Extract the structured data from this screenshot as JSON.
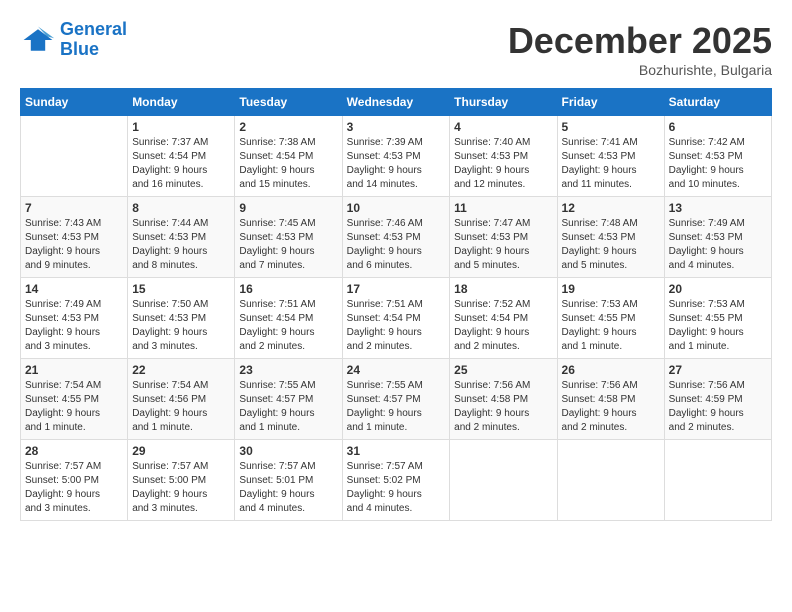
{
  "header": {
    "logo_line1": "General",
    "logo_line2": "Blue",
    "month": "December 2025",
    "location": "Bozhurishte, Bulgaria"
  },
  "weekdays": [
    "Sunday",
    "Monday",
    "Tuesday",
    "Wednesday",
    "Thursday",
    "Friday",
    "Saturday"
  ],
  "weeks": [
    [
      {
        "day": "",
        "info": ""
      },
      {
        "day": "1",
        "info": "Sunrise: 7:37 AM\nSunset: 4:54 PM\nDaylight: 9 hours\nand 16 minutes."
      },
      {
        "day": "2",
        "info": "Sunrise: 7:38 AM\nSunset: 4:54 PM\nDaylight: 9 hours\nand 15 minutes."
      },
      {
        "day": "3",
        "info": "Sunrise: 7:39 AM\nSunset: 4:53 PM\nDaylight: 9 hours\nand 14 minutes."
      },
      {
        "day": "4",
        "info": "Sunrise: 7:40 AM\nSunset: 4:53 PM\nDaylight: 9 hours\nand 12 minutes."
      },
      {
        "day": "5",
        "info": "Sunrise: 7:41 AM\nSunset: 4:53 PM\nDaylight: 9 hours\nand 11 minutes."
      },
      {
        "day": "6",
        "info": "Sunrise: 7:42 AM\nSunset: 4:53 PM\nDaylight: 9 hours\nand 10 minutes."
      }
    ],
    [
      {
        "day": "7",
        "info": "Sunrise: 7:43 AM\nSunset: 4:53 PM\nDaylight: 9 hours\nand 9 minutes."
      },
      {
        "day": "8",
        "info": "Sunrise: 7:44 AM\nSunset: 4:53 PM\nDaylight: 9 hours\nand 8 minutes."
      },
      {
        "day": "9",
        "info": "Sunrise: 7:45 AM\nSunset: 4:53 PM\nDaylight: 9 hours\nand 7 minutes."
      },
      {
        "day": "10",
        "info": "Sunrise: 7:46 AM\nSunset: 4:53 PM\nDaylight: 9 hours\nand 6 minutes."
      },
      {
        "day": "11",
        "info": "Sunrise: 7:47 AM\nSunset: 4:53 PM\nDaylight: 9 hours\nand 5 minutes."
      },
      {
        "day": "12",
        "info": "Sunrise: 7:48 AM\nSunset: 4:53 PM\nDaylight: 9 hours\nand 5 minutes."
      },
      {
        "day": "13",
        "info": "Sunrise: 7:49 AM\nSunset: 4:53 PM\nDaylight: 9 hours\nand 4 minutes."
      }
    ],
    [
      {
        "day": "14",
        "info": "Sunrise: 7:49 AM\nSunset: 4:53 PM\nDaylight: 9 hours\nand 3 minutes."
      },
      {
        "day": "15",
        "info": "Sunrise: 7:50 AM\nSunset: 4:53 PM\nDaylight: 9 hours\nand 3 minutes."
      },
      {
        "day": "16",
        "info": "Sunrise: 7:51 AM\nSunset: 4:54 PM\nDaylight: 9 hours\nand 2 minutes."
      },
      {
        "day": "17",
        "info": "Sunrise: 7:51 AM\nSunset: 4:54 PM\nDaylight: 9 hours\nand 2 minutes."
      },
      {
        "day": "18",
        "info": "Sunrise: 7:52 AM\nSunset: 4:54 PM\nDaylight: 9 hours\nand 2 minutes."
      },
      {
        "day": "19",
        "info": "Sunrise: 7:53 AM\nSunset: 4:55 PM\nDaylight: 9 hours\nand 1 minute."
      },
      {
        "day": "20",
        "info": "Sunrise: 7:53 AM\nSunset: 4:55 PM\nDaylight: 9 hours\nand 1 minute."
      }
    ],
    [
      {
        "day": "21",
        "info": "Sunrise: 7:54 AM\nSunset: 4:55 PM\nDaylight: 9 hours\nand 1 minute."
      },
      {
        "day": "22",
        "info": "Sunrise: 7:54 AM\nSunset: 4:56 PM\nDaylight: 9 hours\nand 1 minute."
      },
      {
        "day": "23",
        "info": "Sunrise: 7:55 AM\nSunset: 4:57 PM\nDaylight: 9 hours\nand 1 minute."
      },
      {
        "day": "24",
        "info": "Sunrise: 7:55 AM\nSunset: 4:57 PM\nDaylight: 9 hours\nand 1 minute."
      },
      {
        "day": "25",
        "info": "Sunrise: 7:56 AM\nSunset: 4:58 PM\nDaylight: 9 hours\nand 2 minutes."
      },
      {
        "day": "26",
        "info": "Sunrise: 7:56 AM\nSunset: 4:58 PM\nDaylight: 9 hours\nand 2 minutes."
      },
      {
        "day": "27",
        "info": "Sunrise: 7:56 AM\nSunset: 4:59 PM\nDaylight: 9 hours\nand 2 minutes."
      }
    ],
    [
      {
        "day": "28",
        "info": "Sunrise: 7:57 AM\nSunset: 5:00 PM\nDaylight: 9 hours\nand 3 minutes."
      },
      {
        "day": "29",
        "info": "Sunrise: 7:57 AM\nSunset: 5:00 PM\nDaylight: 9 hours\nand 3 minutes."
      },
      {
        "day": "30",
        "info": "Sunrise: 7:57 AM\nSunset: 5:01 PM\nDaylight: 9 hours\nand 4 minutes."
      },
      {
        "day": "31",
        "info": "Sunrise: 7:57 AM\nSunset: 5:02 PM\nDaylight: 9 hours\nand 4 minutes."
      },
      {
        "day": "",
        "info": ""
      },
      {
        "day": "",
        "info": ""
      },
      {
        "day": "",
        "info": ""
      }
    ]
  ]
}
